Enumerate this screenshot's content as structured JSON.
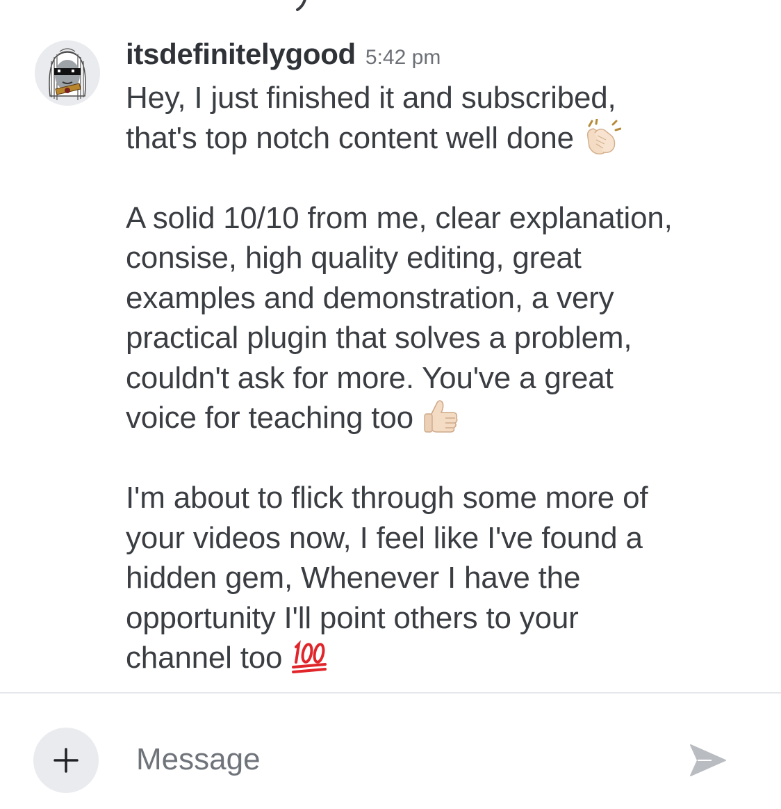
{
  "message": {
    "username": "itsdefinitelygood",
    "timestamp": "5:42 pm",
    "paragraphs": [
      "Hey, I just finished it and subscribed,\nthat's top notch content well done",
      "A solid 10/10 from me, clear explanation,\nconsise, high quality editing, great\nexamples and demonstration, a very\npractical plugin that solves a problem,\ncouldn't ask for more. You've a great\nvoice for teaching too",
      "I'm about to flick through some more of\nyour videos now, I feel like I've found a\nhidden gem, Whenever I have the\nopportunity I'll point others to your\nchannel too"
    ],
    "emojis": [
      "clapping-hands-icon",
      "thumbs-up-icon",
      "hundred-points-icon"
    ]
  },
  "composer": {
    "add_label": "+",
    "placeholder": "Message"
  },
  "colors": {
    "text": "#3a3d42",
    "username": "#2f3237",
    "timestamp": "#6c6f75",
    "divider": "#e6e7ea",
    "button_bg": "#e9ebee",
    "send_icon": "#b9bcc1",
    "hundred_red": "#e0262b"
  }
}
